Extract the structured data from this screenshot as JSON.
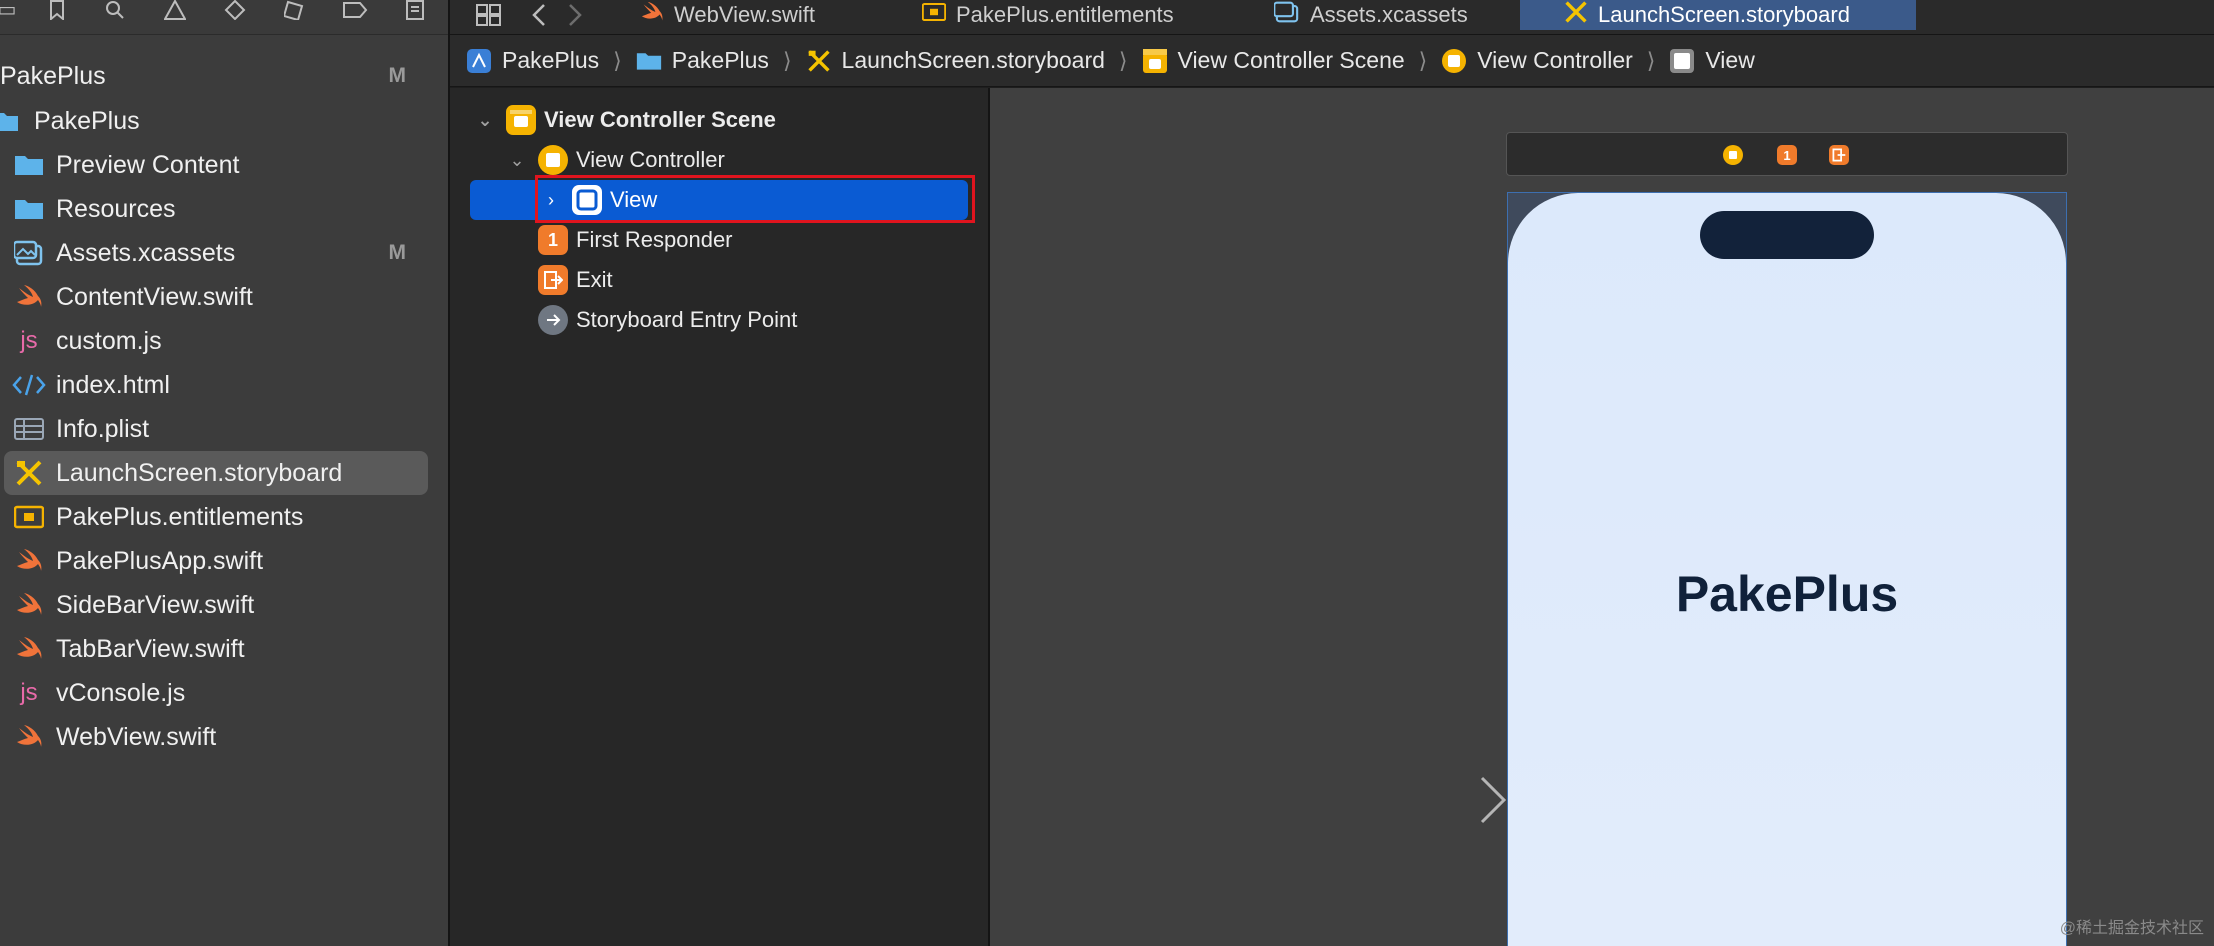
{
  "sidebar": {
    "items": [
      {
        "label": "PakePlus",
        "badge": "M",
        "icon": "none"
      },
      {
        "label": "PakePlus",
        "badge": "",
        "icon": "project-icon"
      },
      {
        "label": "Preview Content",
        "badge": "",
        "icon": "folder-icon"
      },
      {
        "label": "Resources",
        "badge": "",
        "icon": "folder-icon"
      },
      {
        "label": "Assets.xcassets",
        "badge": "M",
        "icon": "assets-icon"
      },
      {
        "label": "ContentView.swift",
        "badge": "",
        "icon": "swift-icon"
      },
      {
        "label": "custom.js",
        "badge": "",
        "icon": "js-icon"
      },
      {
        "label": "index.html",
        "badge": "",
        "icon": "html-icon"
      },
      {
        "label": "Info.plist",
        "badge": "",
        "icon": "plist-icon"
      },
      {
        "label": "LaunchScreen.storyboard",
        "badge": "",
        "icon": "storyboard-icon"
      },
      {
        "label": "PakePlus.entitlements",
        "badge": "",
        "icon": "entitlements-icon"
      },
      {
        "label": "PakePlusApp.swift",
        "badge": "",
        "icon": "swift-icon"
      },
      {
        "label": "SideBarView.swift",
        "badge": "",
        "icon": "swift-icon"
      },
      {
        "label": "TabBarView.swift",
        "badge": "",
        "icon": "swift-icon"
      },
      {
        "label": "vConsole.js",
        "badge": "",
        "icon": "js-icon"
      },
      {
        "label": "WebView.swift",
        "badge": "",
        "icon": "swift-icon"
      }
    ],
    "js_glyph": "js"
  },
  "tabs": [
    {
      "label": "WebView.swift",
      "icon": "swift-icon"
    },
    {
      "label": "PakePlus.entitlements",
      "icon": "entitlements-icon"
    },
    {
      "label": "Assets.xcassets",
      "icon": "assets-icon"
    },
    {
      "label": "LaunchScreen.storyboard",
      "icon": "storyboard-icon",
      "active": true
    }
  ],
  "breadcrumb": [
    {
      "label": "PakePlus",
      "icon": "project-icon"
    },
    {
      "label": "PakePlus",
      "icon": "folder-icon"
    },
    {
      "label": "LaunchScreen.storyboard",
      "icon": "storyboard-icon"
    },
    {
      "label": "View Controller Scene",
      "icon": "scene-icon"
    },
    {
      "label": "View Controller",
      "icon": "view-controller-icon"
    },
    {
      "label": "View",
      "icon": "view-icon"
    }
  ],
  "outline": {
    "scene": "View Controller Scene",
    "view_controller": "View Controller",
    "view": "View",
    "first_responder": "First Responder",
    "first_responder_glyph": "1",
    "exit": "Exit",
    "entry_point": "Storyboard Entry Point"
  },
  "canvas": {
    "app_title": "PakePlus",
    "first_responder_glyph": "1"
  },
  "watermark": "@稀土掘金技术社区",
  "colors": {
    "selection": "#0a5bd3",
    "highlight": "#e0141e",
    "swift": "#f0733a",
    "folder": "#5db3ea",
    "yellow": "#f5b301"
  }
}
